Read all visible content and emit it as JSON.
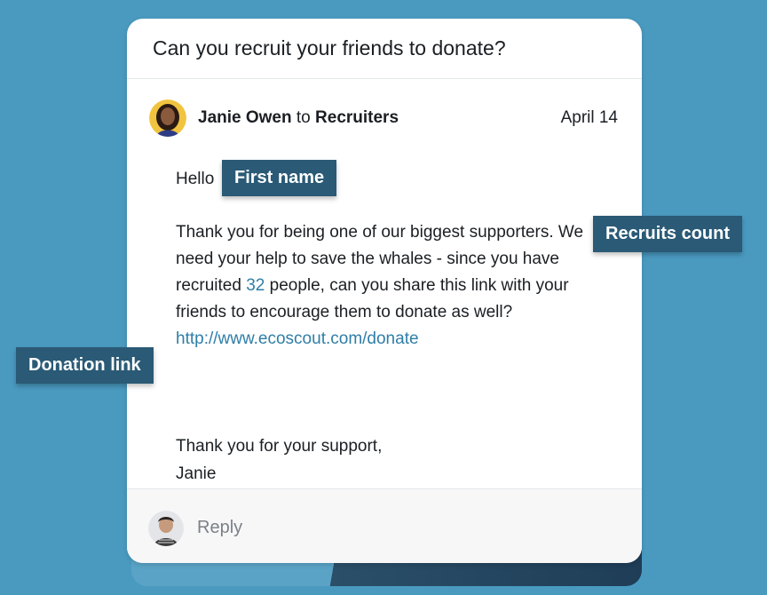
{
  "message": {
    "subject": "Can you recruit your friends to donate?",
    "sender_name": "Janie Owen",
    "to_word": "to",
    "recipient": "Recruiters",
    "date": "April 14",
    "greeting": "Hello",
    "para_a": "Thank you for being one of our biggest supporters. We need your help to save the whales - since you have recruited ",
    "recruit_count": "32",
    "para_b": " people, can you share this link with your friends to encourage them to donate as well?",
    "link": "http://www.ecoscout.com/donate",
    "signoff_line1": "Thank you for your support,",
    "signoff_line2": "Janie"
  },
  "reply": {
    "placeholder": "Reply"
  },
  "tags": {
    "first_name": "First name",
    "recruits_count": "Recruits count",
    "donation_link": "Donation link"
  },
  "colors": {
    "background": "#4a9ac0",
    "tag": "#2a5a76",
    "link": "#2f7ea7"
  }
}
